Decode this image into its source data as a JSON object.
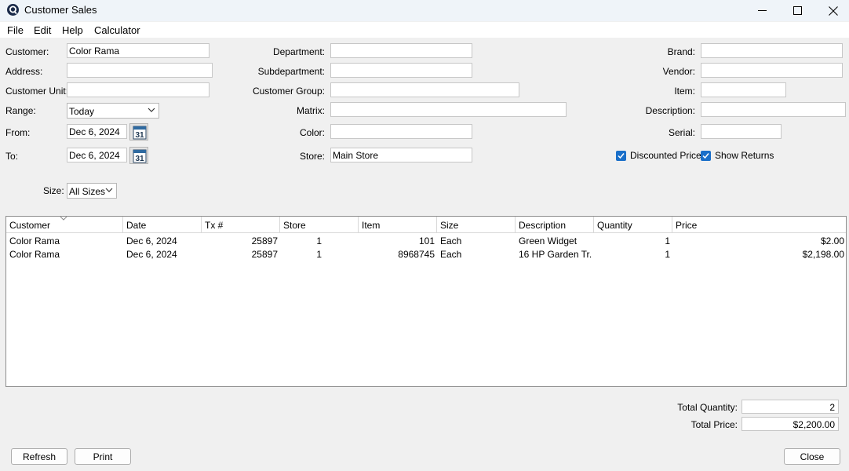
{
  "window": {
    "title": "Customer Sales"
  },
  "menu": [
    "File",
    "Edit",
    "Help",
    "Calculator"
  ],
  "filters": {
    "customer": {
      "label": "Customer:",
      "value": "Color Rama"
    },
    "address": {
      "label": "Address:",
      "value": ""
    },
    "customer_unit": {
      "label": "Customer Unit:",
      "value": ""
    },
    "range": {
      "label": "Range:",
      "value": "Today"
    },
    "from": {
      "label": "From:",
      "value": "Dec 6, 2024"
    },
    "to": {
      "label": "To:",
      "value": "Dec 6, 2024"
    },
    "size": {
      "label": "Size:",
      "value": "All Sizes"
    },
    "department": {
      "label": "Department:",
      "value": ""
    },
    "subdepartment": {
      "label": "Subdepartment:",
      "value": ""
    },
    "customer_group": {
      "label": "Customer Group:",
      "value": ""
    },
    "matrix": {
      "label": "Matrix:",
      "value": ""
    },
    "color": {
      "label": "Color:",
      "value": ""
    },
    "store": {
      "label": "Store:",
      "value": "Main Store"
    },
    "brand": {
      "label": "Brand:",
      "value": ""
    },
    "vendor": {
      "label": "Vendor:",
      "value": ""
    },
    "item": {
      "label": "Item:",
      "value": ""
    },
    "description": {
      "label": "Description:",
      "value": ""
    },
    "serial": {
      "label": "Serial:",
      "value": ""
    },
    "discounted_price": {
      "label": "Discounted Price",
      "checked": true
    },
    "show_returns": {
      "label": "Show Returns",
      "checked": true
    }
  },
  "table": {
    "columns": [
      "Customer",
      "Date",
      "Tx #",
      "Store",
      "Item",
      "Size",
      "Description",
      "Quantity",
      "Price"
    ],
    "rows": [
      [
        "Color Rama",
        "Dec 6, 2024",
        "25897",
        "1",
        "101",
        "Each",
        "Green Widget",
        "1",
        "$2.00"
      ],
      [
        "Color Rama",
        "Dec 6, 2024",
        "25897",
        "1",
        "8968745",
        "Each",
        "16 HP Garden Tr...",
        "1",
        "$2,198.00"
      ]
    ]
  },
  "totals": {
    "quantity_label": "Total Quantity:",
    "quantity_value": "2",
    "price_label": "Total Price:",
    "price_value": "$2,200.00"
  },
  "buttons": {
    "refresh": "Refresh",
    "print": "Print",
    "close": "Close"
  },
  "calendar_day": "31",
  "colors": {
    "accent": "#1a6fc9",
    "titlebar": "#eff4f9",
    "background": "#f0f0f0"
  }
}
